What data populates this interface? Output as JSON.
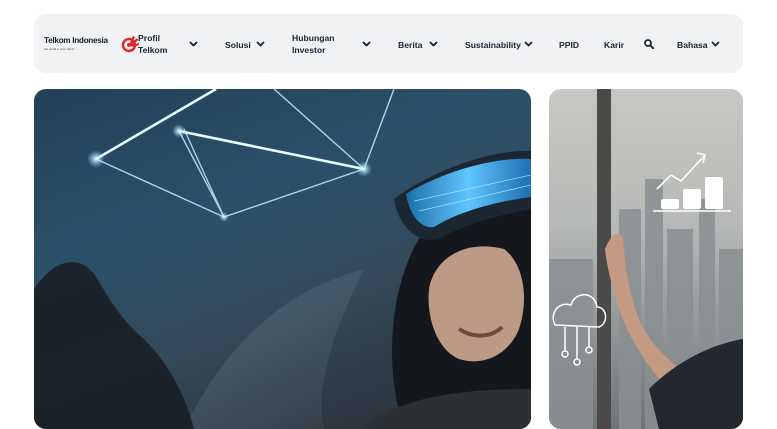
{
  "brand": {
    "name": "Telkom Indonesia",
    "tagline": "the world in your hand",
    "accent": "#e4252b"
  },
  "nav": {
    "items": [
      {
        "label_line1": "Profil",
        "label_line2": "Telkom",
        "has_dropdown": true
      },
      {
        "label": "Solusi",
        "has_dropdown": true
      },
      {
        "label_line1": "Hubungan",
        "label_line2": "Investor",
        "has_dropdown": true
      },
      {
        "label": "Berita",
        "has_dropdown": true
      },
      {
        "label": "Sustainability",
        "has_dropdown": true
      },
      {
        "label": "PPID",
        "has_dropdown": false
      },
      {
        "label": "Karir",
        "has_dropdown": false
      }
    ],
    "search_icon": "search-icon",
    "language": {
      "label": "Bahasa",
      "has_dropdown": true
    }
  },
  "hero": {
    "main_image": "woman-vr-headset-network-lines",
    "side_image": "businessperson-city-growth-chart"
  }
}
